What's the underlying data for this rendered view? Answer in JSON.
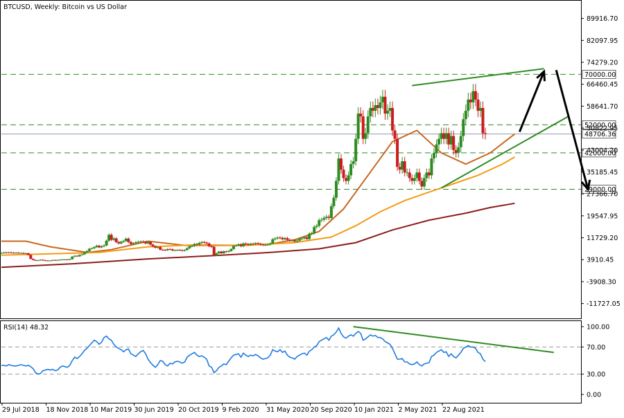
{
  "chart_data": {
    "type": "candlestick",
    "symbol": "BTCUSD",
    "timeframe": "Weekly",
    "description": "Bitcoin vs US Dollar",
    "price_axis": {
      "min": -17000,
      "max": 96000,
      "ticks": [
        "89916.70",
        "82097.95",
        "74279.20",
        "66460.45",
        "58641.70",
        "50822.95",
        "43004.20",
        "35185.45",
        "27366.70",
        "19547.95",
        "11729.20",
        "3910.45",
        "-3908.30",
        "-11727.05"
      ]
    },
    "current_price": 48706.36,
    "current_price_label": "48706.36",
    "horizontal_levels": [
      {
        "value": 70000,
        "label": "70000.00"
      },
      {
        "value": 52000,
        "label": "52000.00"
      },
      {
        "value": 42000,
        "label": "42000.00"
      },
      {
        "value": 29000,
        "label": "29000.00"
      }
    ],
    "x_axis": {
      "ticks": [
        "29 Jul 2018",
        "18 Nov 2018",
        "10 Mar 2019",
        "30 Jun 2019",
        "20 Oct 2019",
        "9 Feb 2020",
        "31 May 2020",
        "20 Sep 2020",
        "10 Jan 2021",
        "2 May 2021",
        "22 Aug 2021"
      ]
    },
    "closes": [
      6300,
      6500,
      6400,
      6500,
      6400,
      6300,
      6400,
      6300,
      6300,
      6200,
      6200,
      5600,
      4200,
      3800,
      3600,
      3700,
      3900,
      3700,
      3600,
      3500,
      3600,
      3800,
      3700,
      3800,
      3900,
      4000,
      4000,
      3900,
      4100,
      5000,
      5300,
      5100,
      5600,
      5800,
      6500,
      7000,
      7800,
      8000,
      8400,
      8900,
      8300,
      8700,
      9000,
      10700,
      12800,
      11000,
      11500,
      10200,
      9700,
      10300,
      10600,
      11400,
      10200,
      9500,
      9800,
      10100,
      10300,
      10400,
      10200,
      9700,
      10200,
      9300,
      8700,
      8200,
      8400,
      7500,
      7400,
      7300,
      7700,
      7600,
      7200,
      7300,
      7400,
      7300,
      7100,
      7400,
      8000,
      8700,
      8800,
      9500,
      9300,
      9900,
      10200,
      10000,
      9700,
      8700,
      8500,
      5400,
      6200,
      6800,
      6200,
      6900,
      6700,
      7000,
      7700,
      8800,
      9000,
      9400,
      8700,
      9700,
      9500,
      9200,
      9600,
      9500,
      9800,
      9600,
      9300,
      9100,
      9200,
      9300,
      9700,
      11200,
      11500,
      11800,
      11700,
      11200,
      11600,
      11000,
      10700,
      10800,
      10400,
      10700,
      11300,
      11500,
      11900,
      11300,
      13200,
      13400,
      15600,
      16000,
      18000,
      18200,
      18800,
      19200,
      18800,
      23000,
      26000,
      32000,
      40000,
      36000,
      33000,
      32000,
      34000,
      38000,
      39000,
      47000,
      56000,
      55000,
      47000,
      49000,
      55000,
      58000,
      57000,
      59000,
      58000,
      60000,
      62000,
      56000,
      57000,
      58000,
      50000,
      47000,
      37000,
      36000,
      39000,
      35000,
      35000,
      33000,
      32000,
      33000,
      35000,
      32000,
      30000,
      33000,
      35000,
      34000,
      40000,
      42000,
      45000,
      47000,
      49000,
      47000,
      49000,
      45000,
      48000,
      43000,
      42000,
      44000,
      48000,
      54000,
      57000,
      61000,
      60000,
      64000,
      61000,
      57000,
      58000,
      49000,
      48706
    ],
    "moving_averages": [
      {
        "name": "MA short",
        "color": "#c8671e",
        "points": [
          [
            0,
            10500
          ],
          [
            10,
            10500
          ],
          [
            20,
            8500
          ],
          [
            35,
            6500
          ],
          [
            45,
            7500
          ],
          [
            60,
            10500
          ],
          [
            75,
            9000
          ],
          [
            95,
            9000
          ],
          [
            110,
            9500
          ],
          [
            120,
            11000
          ],
          [
            130,
            14000
          ],
          [
            140,
            22000
          ],
          [
            150,
            34000
          ],
          [
            160,
            46000
          ],
          [
            170,
            50000
          ],
          [
            180,
            42000
          ],
          [
            190,
            38000
          ],
          [
            200,
            42000
          ],
          [
            210,
            48706
          ]
        ]
      },
      {
        "name": "MA medium",
        "color": "#f59a14",
        "points": [
          [
            0,
            5500
          ],
          [
            20,
            6000
          ],
          [
            40,
            6500
          ],
          [
            60,
            8500
          ],
          [
            80,
            9200
          ],
          [
            100,
            9000
          ],
          [
            120,
            10000
          ],
          [
            135,
            12000
          ],
          [
            145,
            16000
          ],
          [
            155,
            21000
          ],
          [
            165,
            25000
          ],
          [
            175,
            28000
          ],
          [
            185,
            31000
          ],
          [
            195,
            34000
          ],
          [
            205,
            38000
          ],
          [
            210,
            40500
          ]
        ]
      },
      {
        "name": "MA long",
        "color": "#8b1c1c",
        "points": [
          [
            0,
            1200
          ],
          [
            30,
            2500
          ],
          [
            60,
            4200
          ],
          [
            90,
            5500
          ],
          [
            110,
            6500
          ],
          [
            130,
            7800
          ],
          [
            145,
            10000
          ],
          [
            160,
            14500
          ],
          [
            175,
            18000
          ],
          [
            190,
            20500
          ],
          [
            200,
            22500
          ],
          [
            210,
            24000
          ]
        ]
      }
    ],
    "annotations": [
      {
        "name": "upper-trendline",
        "color": "#2e8b22",
        "points": [
          [
            168,
            66000
          ],
          [
            222,
            72000
          ]
        ]
      },
      {
        "name": "lower-trendline",
        "color": "#2e8b22",
        "points": [
          [
            180,
            29500
          ],
          [
            232,
            55000
          ]
        ]
      }
    ],
    "arrows": [
      {
        "name": "up-arrow",
        "from": [
          212,
          49500
        ],
        "to": [
          222,
          71000
        ]
      },
      {
        "name": "down-arrow",
        "from": [
          227,
          71500
        ],
        "to": [
          240,
          29000
        ]
      }
    ]
  },
  "rsi_panel": {
    "label": "RSI(14) 48.32",
    "ticks": [
      "100.00",
      "70.00",
      "30.00",
      "0.00"
    ],
    "levels": [
      70,
      30
    ],
    "color": "#1f7ae0",
    "values": [
      43,
      43,
      42,
      44,
      43,
      42,
      42,
      43,
      44,
      43,
      42,
      43,
      41,
      38,
      32,
      30,
      31,
      35,
      36,
      37,
      36,
      37,
      35,
      36,
      40,
      42,
      41,
      40,
      43,
      50,
      55,
      53,
      56,
      60,
      65,
      68,
      72,
      76,
      80,
      78,
      74,
      77,
      84,
      86,
      82,
      80,
      74,
      70,
      68,
      66,
      63,
      66,
      67,
      60,
      58,
      56,
      60,
      63,
      65,
      60,
      52,
      47,
      43,
      40,
      44,
      50,
      49,
      44,
      42,
      46,
      45,
      48,
      49,
      48,
      46,
      48,
      55,
      58,
      60,
      62,
      58,
      56,
      57,
      55,
      52,
      42,
      40,
      32,
      35,
      40,
      42,
      45,
      44,
      49,
      54,
      58,
      59,
      60,
      55,
      61,
      58,
      56,
      58,
      57,
      59,
      57,
      54,
      52,
      53,
      54,
      58,
      66,
      64,
      63,
      66,
      62,
      64,
      58,
      55,
      54,
      52,
      56,
      58,
      60,
      61,
      58,
      64,
      66,
      70,
      72,
      78,
      80,
      82,
      84,
      80,
      86,
      88,
      92,
      98,
      90,
      85,
      83,
      86,
      88,
      86,
      90,
      93,
      90,
      80,
      82,
      85,
      88,
      86,
      87,
      84,
      84,
      82,
      78,
      76,
      74,
      68,
      60,
      52,
      52,
      53,
      48,
      48,
      45,
      44,
      45,
      48,
      44,
      42,
      45,
      46,
      47,
      56,
      58,
      62,
      64,
      66,
      62,
      63,
      56,
      60,
      56,
      54,
      58,
      62,
      68,
      70,
      72,
      70,
      70,
      68,
      62,
      60,
      52,
      48.32
    ],
    "trendline": {
      "color": "#2e8b22",
      "points": [
        [
          144,
          100
        ],
        [
          226,
          62
        ]
      ]
    }
  }
}
